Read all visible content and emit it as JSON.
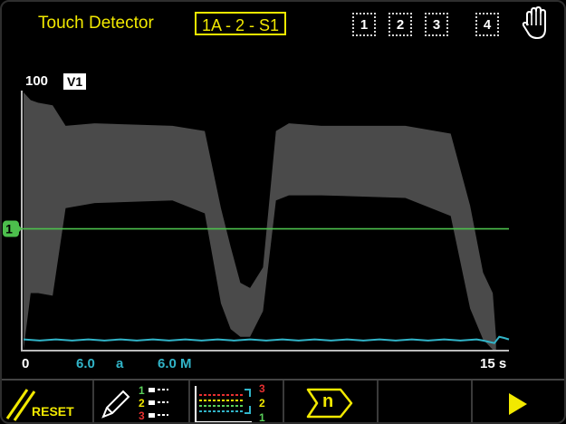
{
  "header": {
    "title": "Touch Detector",
    "channel": "1A - 2 - S1",
    "slots": [
      "1",
      "2",
      "3",
      "4"
    ],
    "hand_icon": "hand-icon"
  },
  "plot": {
    "y_top_label": "100",
    "trace_badge": "V1",
    "marker_label": "1",
    "x_start_label": "0",
    "x_end_label": "15 s",
    "readout_1": "6.0",
    "readout_1_unit": "a",
    "readout_2": "6.0 M"
  },
  "toolbar": {
    "reset_label": "RESET",
    "channel_list_numbers": [
      "1",
      "2",
      "3"
    ],
    "trace_stack_numbers": [
      "3",
      "2",
      "1"
    ],
    "n_button_label": "n"
  },
  "colors": {
    "accent": "#f2e900",
    "trace_band": "#4a4a4a",
    "threshold_line": "#4cbf4c",
    "baseline_trace": "#31b4c8"
  },
  "chart_data": {
    "type": "area",
    "x_range": [
      0,
      15
    ],
    "y_range": [
      0,
      100
    ],
    "xlabel": "",
    "ylabel": "",
    "threshold": 47,
    "band": {
      "x": [
        0,
        0.22,
        0.45,
        0.9,
        1.3,
        2.2,
        4.6,
        5.6,
        6.1,
        6.4,
        6.7,
        7.0,
        7.4,
        7.8,
        8.2,
        9.2,
        11.8,
        13.2,
        13.8,
        14.2,
        14.5,
        14.6
      ],
      "upper": [
        100,
        97,
        96,
        95,
        87,
        88,
        87,
        85,
        55,
        40,
        26,
        24,
        32,
        85,
        88,
        87,
        87,
        84,
        56,
        30,
        22,
        5
      ],
      "lower": [
        0,
        22,
        22,
        21,
        55,
        57,
        58,
        53,
        18,
        8,
        5,
        5,
        15,
        58,
        60,
        60,
        59,
        52,
        16,
        4,
        0,
        0
      ]
    },
    "baseline": {
      "x": [
        0,
        1,
        2,
        3,
        4,
        5,
        6,
        7,
        8,
        9,
        10,
        11,
        12,
        13,
        14,
        14.4,
        14.7,
        15
      ],
      "y": [
        4,
        4,
        4,
        4,
        4,
        4,
        4,
        4,
        4,
        4,
        4,
        4,
        4,
        4,
        4,
        3,
        5,
        4
      ]
    }
  }
}
